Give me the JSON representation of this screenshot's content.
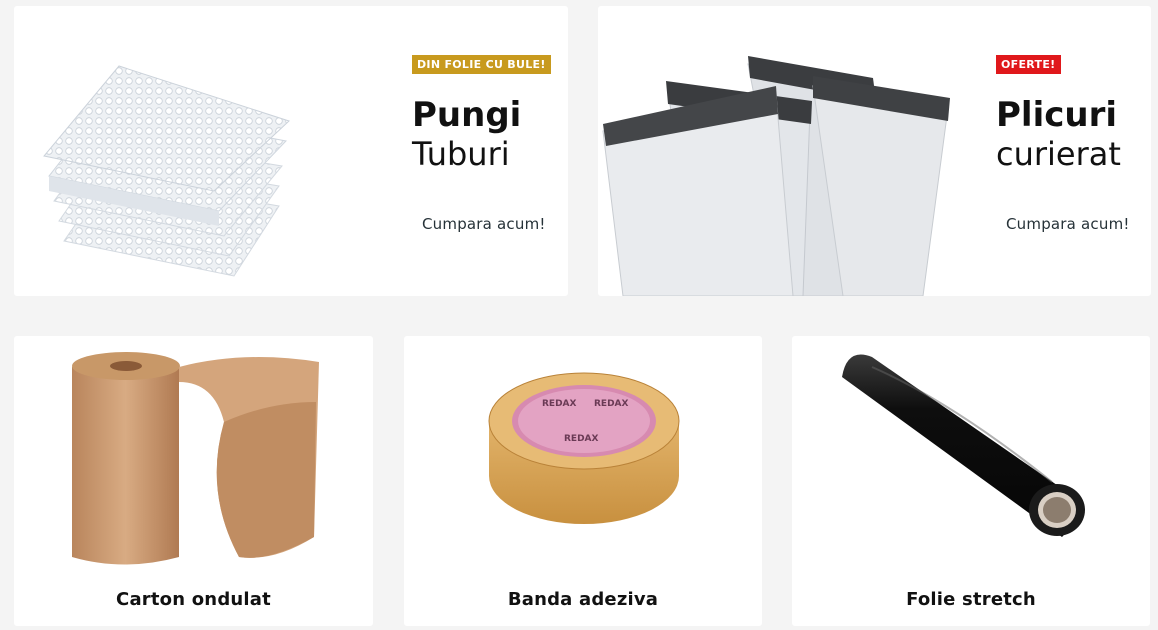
{
  "promos": [
    {
      "badge": "DIN FOLIE CU BULE!",
      "badge_color": "#c89a1e",
      "title": "Pungi",
      "subtitle": "Tuburi",
      "cta": "Cumpara acum!",
      "image_icon": "bubble-wrap-bags"
    },
    {
      "badge": "OFERTE!",
      "badge_color": "#e0181b",
      "title": "Plicuri",
      "subtitle": "curierat",
      "cta": "Cumpara acum!",
      "image_icon": "courier-envelopes"
    }
  ],
  "categories": [
    {
      "label": "Carton ondulat",
      "image_icon": "corrugated-cardboard-roll"
    },
    {
      "label": "Banda adeziva",
      "image_icon": "adhesive-tape-roll",
      "tape_brand": "REDAX"
    },
    {
      "label": "Folie stretch",
      "image_icon": "stretch-film-roll"
    }
  ]
}
